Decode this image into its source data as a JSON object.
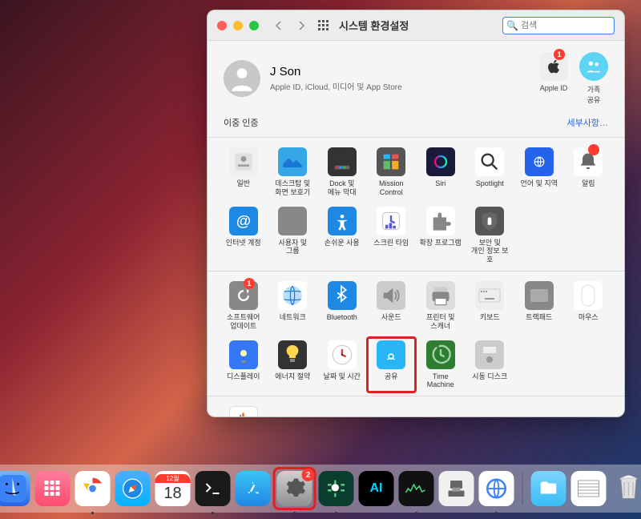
{
  "window": {
    "title": "시스템 환경설정",
    "search_placeholder": "검색"
  },
  "account": {
    "name": "J Son",
    "subtitle": "Apple ID, iCloud, 미디어 및 App Store",
    "apple_id_label": "Apple ID",
    "apple_id_badge": "1",
    "family_label": "가족\n공유"
  },
  "update": {
    "label": "이중 인증",
    "details": "세부사항…"
  },
  "row1": [
    {
      "label": "일반",
      "icon": "general",
      "bg": "#f0f0f0"
    },
    {
      "label": "데스크탑 및\n화면 보호기",
      "icon": "desktop",
      "bg": "#35a6e6"
    },
    {
      "label": "Dock 및\n메뉴 막대",
      "icon": "dock",
      "bg": "#333"
    },
    {
      "label": "Mission\nControl",
      "icon": "mission",
      "bg": "#555"
    },
    {
      "label": "Siri",
      "icon": "siri",
      "bg": "#1a1a3a"
    },
    {
      "label": "Spotlight",
      "icon": "spotlight",
      "bg": "#fff"
    },
    {
      "label": "언어 및 지역",
      "icon": "lang",
      "bg": "#2563eb"
    },
    {
      "label": "알림",
      "icon": "notif",
      "bg": "#fff",
      "badge": true
    }
  ],
  "row2": [
    {
      "label": "인터넷 계정",
      "icon": "internet",
      "bg": "#1e88e5"
    },
    {
      "label": "사용자 및\n그룹",
      "icon": "users",
      "bg": "#888"
    },
    {
      "label": "손쉬운 사용",
      "icon": "access",
      "bg": "#1e88e5"
    },
    {
      "label": "스크린 타임",
      "icon": "screentime",
      "bg": "#fff"
    },
    {
      "label": "확장 프로그램",
      "icon": "ext",
      "bg": "#fff"
    },
    {
      "label": "보안 및\n개인 정보 보호",
      "icon": "security",
      "bg": "#555"
    }
  ],
  "row3": [
    {
      "label": "소프트웨어\n업데이트",
      "icon": "update",
      "bg": "#888",
      "badge": "1"
    },
    {
      "label": "네트워크",
      "icon": "network",
      "bg": "#fff"
    },
    {
      "label": "Bluetooth",
      "icon": "bt",
      "bg": "#1e88e5"
    },
    {
      "label": "사운드",
      "icon": "sound",
      "bg": "#ccc"
    },
    {
      "label": "프린터 및\n스캐너",
      "icon": "printer",
      "bg": "#ddd"
    },
    {
      "label": "키보드",
      "icon": "keyboard",
      "bg": "#eee"
    },
    {
      "label": "트랙패드",
      "icon": "trackpad",
      "bg": "#888"
    },
    {
      "label": "마우스",
      "icon": "mouse",
      "bg": "#fff"
    }
  ],
  "row4": [
    {
      "label": "디스플레이",
      "icon": "display",
      "bg": "#3478f6"
    },
    {
      "label": "에너지 절약",
      "icon": "energy",
      "bg": "#333"
    },
    {
      "label": "날짜 및 시간",
      "icon": "datetime",
      "bg": "#fff"
    },
    {
      "label": "공유",
      "icon": "sharing",
      "bg": "#29b6f6",
      "highlight": true
    },
    {
      "label": "Time\nMachine",
      "icon": "tm",
      "bg": "#2e7d32"
    },
    {
      "label": "시동 디스크",
      "icon": "startup",
      "bg": "#ccc"
    }
  ],
  "row5": [
    {
      "label": "Java",
      "icon": "java",
      "bg": "#fff"
    }
  ],
  "dock": {
    "calendar_month": "12월",
    "calendar_day": "18",
    "settings_badge": "2"
  }
}
